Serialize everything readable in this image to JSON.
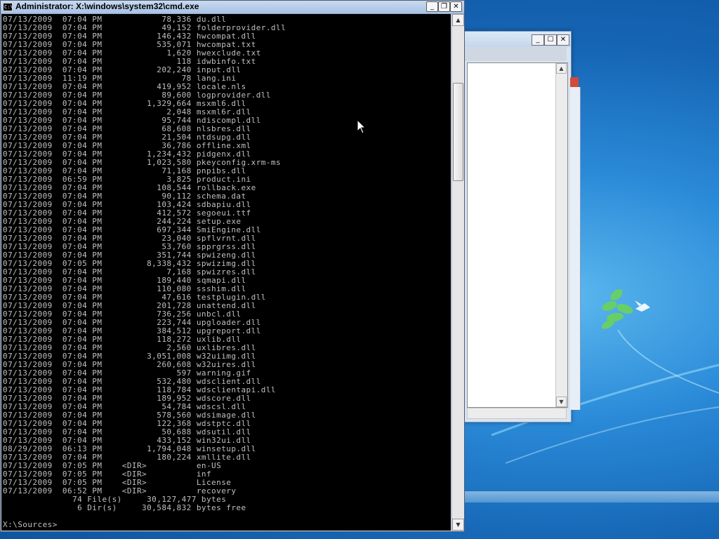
{
  "window": {
    "title": "Administrator: X:\\windows\\system32\\cmd.exe",
    "icon_text": "C:\\",
    "controls": {
      "minimize": "_",
      "maximize": "❐",
      "close": "✕"
    }
  },
  "background_window": {
    "controls": {
      "minimize": "_",
      "maximize": "☐",
      "close": "✕"
    }
  },
  "console": {
    "lines": [
      "07/13/2009  07:04 PM            78,336 du.dll",
      "07/13/2009  07:04 PM            49,152 folderprovider.dll",
      "07/13/2009  07:04 PM           146,432 hwcompat.dll",
      "07/13/2009  07:04 PM           535,071 hwcompat.txt",
      "07/13/2009  07:04 PM             1,620 hwexclude.txt",
      "07/13/2009  07:04 PM               118 idwbinfo.txt",
      "07/13/2009  07:04 PM           202,240 input.dll",
      "07/13/2009  11:19 PM                78 lang.ini",
      "07/13/2009  07:04 PM           419,952 locale.nls",
      "07/13/2009  07:04 PM            89,600 logprovider.dll",
      "07/13/2009  07:04 PM         1,329,664 msxml6.dll",
      "07/13/2009  07:04 PM             2,048 msxml6r.dll",
      "07/13/2009  07:04 PM            95,744 ndiscompl.dll",
      "07/13/2009  07:04 PM            68,608 nlsbres.dll",
      "07/13/2009  07:04 PM            21,504 ntdsupg.dll",
      "07/13/2009  07:04 PM            36,786 offline.xml",
      "07/13/2009  07:04 PM         1,234,432 pidgenx.dll",
      "07/13/2009  07:04 PM         1,023,580 pkeyconfig.xrm-ms",
      "07/13/2009  07:04 PM            71,168 pnpibs.dll",
      "07/13/2009  06:59 PM             3,825 product.ini",
      "07/13/2009  07:04 PM           108,544 rollback.exe",
      "07/13/2009  07:04 PM            90,112 schema.dat",
      "07/13/2009  07:04 PM           103,424 sdbapiu.dll",
      "07/13/2009  07:04 PM           412,572 segoeui.ttf",
      "07/13/2009  07:04 PM           244,224 setup.exe",
      "07/13/2009  07:04 PM           697,344 SmiEngine.dll",
      "07/13/2009  07:04 PM            23,040 spflvrnt.dll",
      "07/13/2009  07:04 PM            53,760 spprgrss.dll",
      "07/13/2009  07:04 PM           351,744 spwizeng.dll",
      "07/13/2009  07:05 PM         8,338,432 spwizimg.dll",
      "07/13/2009  07:04 PM             7,168 spwizres.dll",
      "07/13/2009  07:04 PM           189,440 sqmapi.dll",
      "07/13/2009  07:04 PM           110,080 ssshim.dll",
      "07/13/2009  07:04 PM            47,616 testplugin.dll",
      "07/13/2009  07:04 PM           201,728 unattend.dll",
      "07/13/2009  07:04 PM           736,256 unbcl.dll",
      "07/13/2009  07:04 PM           223,744 upgloader.dll",
      "07/13/2009  07:04 PM           384,512 upgreport.dll",
      "07/13/2009  07:04 PM           118,272 uxlib.dll",
      "07/13/2009  07:04 PM             2,560 uxlibres.dll",
      "07/13/2009  07:04 PM         3,051,008 w32uiimg.dll",
      "07/13/2009  07:04 PM           260,608 w32uires.dll",
      "07/13/2009  07:04 PM               597 warning.gif",
      "07/13/2009  07:04 PM           532,480 wdsclient.dll",
      "07/13/2009  07:04 PM           118,784 wdsclientapi.dll",
      "07/13/2009  07:04 PM           189,952 wdscore.dll",
      "07/13/2009  07:04 PM            54,784 wdscsl.dll",
      "07/13/2009  07:04 PM           578,560 wdsimage.dll",
      "07/13/2009  07:04 PM           122,368 wdstptc.dll",
      "07/13/2009  07:04 PM            50,688 wdsutil.dll",
      "07/13/2009  07:04 PM           433,152 win32ui.dll",
      "08/29/2009  06:13 PM         1,794,048 winsetup.dll",
      "07/13/2009  07:04 PM           180,224 xmllite.dll",
      "07/13/2009  07:05 PM    <DIR>          en-US",
      "07/13/2009  07:05 PM    <DIR>          inf",
      "07/13/2009  07:05 PM    <DIR>          License",
      "07/13/2009  06:52 PM    <DIR>          recovery",
      "              74 File(s)     30,127,477 bytes",
      "               6 Dir(s)     30,584,832 bytes free",
      "",
      "X:\\Sources>"
    ]
  },
  "scrollbar": {
    "up_arrow": "▲",
    "down_arrow": "▼"
  },
  "colors": {
    "console_bg": "#000000",
    "console_fg": "#c0c0c0",
    "desktop_bg": "#1a78c6"
  }
}
